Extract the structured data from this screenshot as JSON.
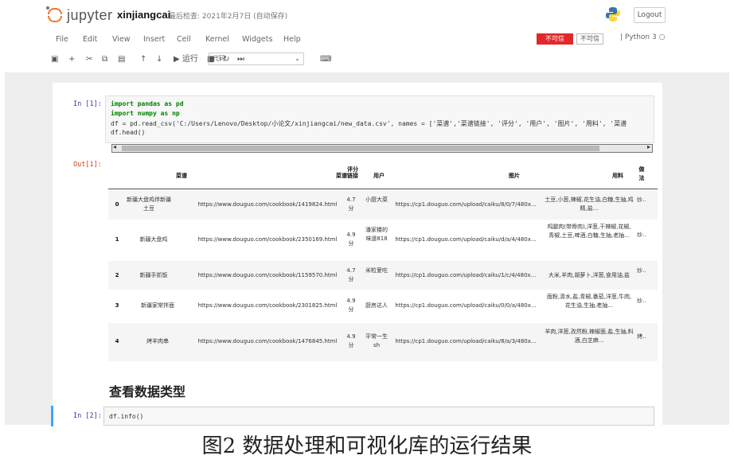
{
  "header": {
    "logo_text": "jupyter",
    "notebook_name": "xinjiangcai",
    "checkpoint": "最后检查: 2021年2月7日  (自动保存)",
    "logout": "Logout"
  },
  "menu": [
    "File",
    "Edit",
    "View",
    "Insert",
    "Cell",
    "Kernel",
    "Widgets",
    "Help"
  ],
  "status": {
    "not_safe": "不可信",
    "trusted": "不可信",
    "kernel": "Python 3"
  },
  "toolbar": {
    "run_label": "运行",
    "cell_type": "代码"
  },
  "cell1": {
    "in_prompt": "In  [1]:",
    "out_prompt": "Out[1]:",
    "code": [
      "import pandas as pd",
      "import numpy as np",
      "df = pd.read_csv('C:/Users/Lenovo/Desktop/小论文/xinjiangcai/new_data.csv', names = ['菜谱','菜谱链接', '评分', '用户', '图片', '用料', '菜谱",
      "df.head()"
    ]
  },
  "dataframe": {
    "columns": [
      "",
      "菜谱",
      "菜谱链接",
      "评分",
      "用户",
      "图片",
      "用料",
      "做法"
    ],
    "rows": [
      [
        "0",
        "新疆大盘鸡伴新疆土豆",
        "https://www.douguo.com/cookbook/1419824.html",
        "4.7分",
        "小厨大菜",
        "https://cp1.douguo.com/upload/caiku/8/0/7/480x...",
        "土豆,小葱,辣椒,花生油,白糖,生抽,鸡精,盐...",
        "炒..."
      ],
      [
        "1",
        "新疆大盘鸡",
        "https://www.douguo.com/cookbook/2350169.html",
        "4.9分",
        "潘家楼的味道818",
        "https://cp1.douguo.com/upload/caiku/d/a/4/480x...",
        "鸡腿肉(带骨肉),洋葱,干辣椒,花椒,青椒,土豆,啤酒,白糖,生抽,老抽...",
        "炒..."
      ],
      [
        "2",
        "新疆手抓饭",
        "https://www.douguo.com/cookbook/1159570.html",
        "4.7分",
        "米粒爱吃",
        "https://cp1.douguo.com/upload/caiku/1/c/4/480x...",
        "大米,羊肉,胡萝卜,洋葱,食用油,盐",
        "炒..."
      ],
      [
        "3",
        "新疆家常拌面",
        "https://www.douguo.com/cookbook/2301825.html",
        "4.9分",
        "厨房达人",
        "https://cp1.douguo.com/upload/caiku/0/0/a/480x...",
        "面粉,清水,盐,青椒,番茄,洋葱,牛肉,花生油,生抽,老抽...",
        "炒..."
      ],
      [
        "4",
        "烤羊肉串",
        "https://www.douguo.com/cookbook/1476845.html",
        "4.9分",
        "平常一生sh",
        "https://cp1.douguo.com/upload/caiku/8/a/3/480x...",
        "羊肉,洋葱,孜然粉,辣椒面,盐,生抽,料酒,白芝麻...",
        "烤..."
      ]
    ]
  },
  "section_title": "查看数据类型",
  "cell2": {
    "in_prompt": "In  [2]:",
    "code": "df.info()"
  },
  "caption": "图2   数据处理和可视化库的运行结果"
}
